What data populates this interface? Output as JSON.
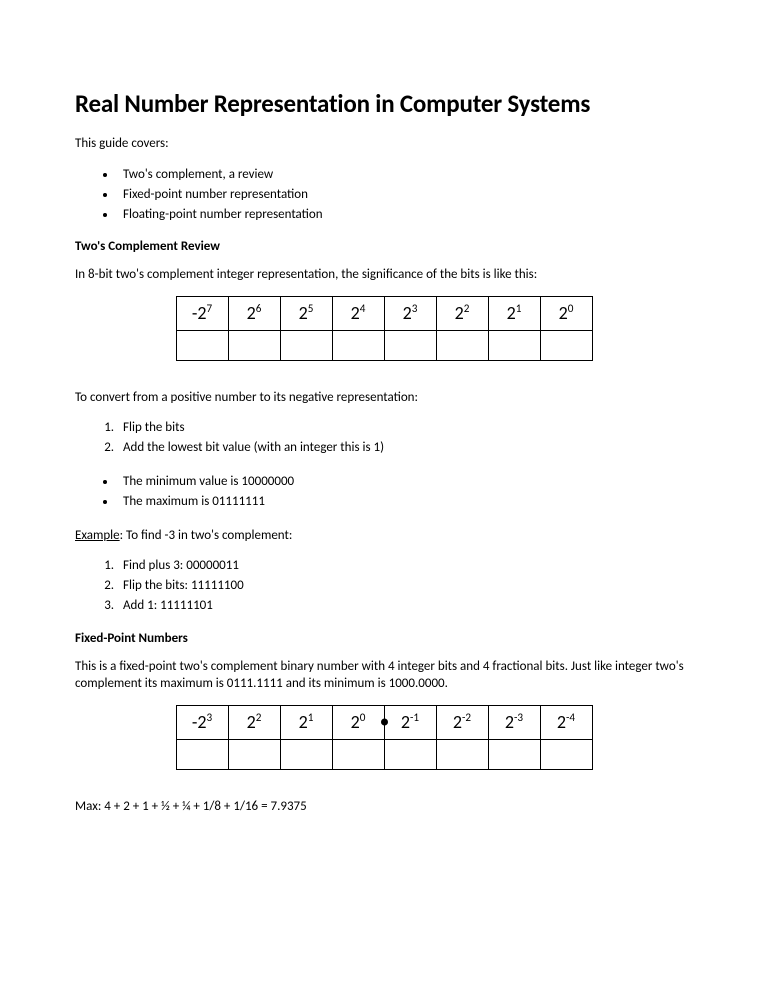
{
  "title": "Real Number Representation in Computer Systems",
  "intro": "This guide covers:",
  "topics": [
    "Two's complement, a review",
    "Fixed-point number representation",
    "Floating-point number representation"
  ],
  "section1_head": "Two's Complement Review",
  "section1_intro": "In 8-bit two's complement integer representation, the significance of the bits is like this:",
  "table1": [
    {
      "base": "-2",
      "exp": "7"
    },
    {
      "base": "2",
      "exp": "6"
    },
    {
      "base": "2",
      "exp": "5"
    },
    {
      "base": "2",
      "exp": "4"
    },
    {
      "base": "2",
      "exp": "3"
    },
    {
      "base": "2",
      "exp": "2"
    },
    {
      "base": "2",
      "exp": "1"
    },
    {
      "base": "2",
      "exp": "0"
    }
  ],
  "conv_intro": "To convert from a positive number to its negative representation:",
  "conv_steps": [
    "Flip the bits",
    "Add the lowest bit value (with an integer this is 1)"
  ],
  "minmax": [
    "The minimum value is 10000000",
    "The maximum is 01111111"
  ],
  "example_label": "Example",
  "example_rest": ": To find -3 in two's complement:",
  "example_steps": [
    "Find plus 3: 00000011",
    "Flip the bits: 11111100",
    "Add 1: 11111101"
  ],
  "section2_head": "Fixed-Point Numbers",
  "section2_intro": "This is a fixed-point two's complement binary number with 4 integer bits and 4 fractional bits. Just like integer two's complement its maximum is 0111.1111 and its minimum is 1000.0000.",
  "table2": [
    {
      "base": "-2",
      "exp": "3",
      "dot": false
    },
    {
      "base": "2",
      "exp": "2",
      "dot": false
    },
    {
      "base": "2",
      "exp": "1",
      "dot": false
    },
    {
      "base": "2",
      "exp": "0",
      "dot": false
    },
    {
      "base": "2",
      "exp": "-1",
      "dot": true
    },
    {
      "base": "2",
      "exp": "-2",
      "dot": false
    },
    {
      "base": "2",
      "exp": "-3",
      "dot": false
    },
    {
      "base": "2",
      "exp": "-4",
      "dot": false
    }
  ],
  "max_line": "Max: 4 + 2 + 1 + ½ + ¼ + 1/8 + 1/16 = 7.9375"
}
